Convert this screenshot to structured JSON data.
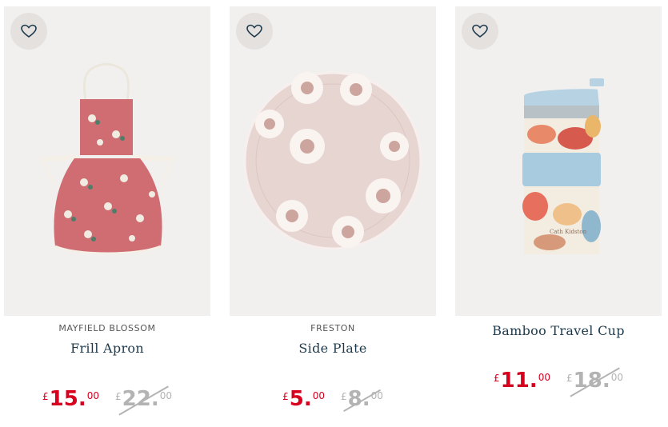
{
  "products": [
    {
      "collection": "MAYFIELD BLOSSOM",
      "name": "Frill Apron",
      "price_now": {
        "currency": "£",
        "main": "15.",
        "dec": "00"
      },
      "price_was": {
        "currency": "£",
        "main": "22.",
        "dec": "00"
      }
    },
    {
      "collection": "FRESTON",
      "name": "Side Plate",
      "price_now": {
        "currency": "£",
        "main": "5.",
        "dec": "00"
      },
      "price_was": {
        "currency": "£",
        "main": "8.",
        "dec": "00"
      }
    },
    {
      "collection": "",
      "name": "Bamboo Travel Cup",
      "price_now": {
        "currency": "£",
        "main": "11.",
        "dec": "00"
      },
      "price_was": {
        "currency": "£",
        "main": "18.",
        "dec": "00"
      }
    }
  ],
  "colors": {
    "sale_red": "#d7001f",
    "was_grey": "#b3b3b3",
    "name_navy": "#1d3a4c",
    "image_bg": "#f2f0ef"
  },
  "icons": [
    "heart-icon"
  ]
}
